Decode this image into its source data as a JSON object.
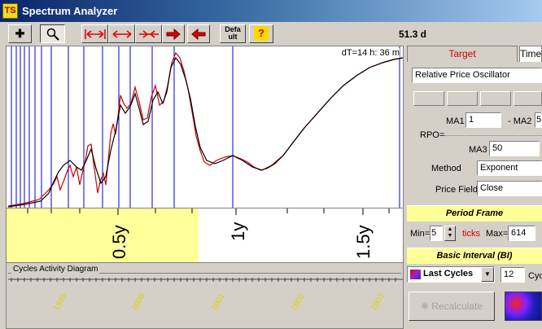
{
  "window": {
    "title": "Spectrum Analyzer",
    "logo_text": "TS"
  },
  "toolbar": {
    "buttons": [
      {
        "name": "crosshair-icon",
        "glyph": "✚"
      },
      {
        "name": "zoom-icon",
        "glyph": "🔍"
      },
      {
        "name": "range-both-icon"
      },
      {
        "name": "expand-icon"
      },
      {
        "name": "compress-icon"
      },
      {
        "name": "arrow-right-icon"
      },
      {
        "name": "arrow-left-icon"
      },
      {
        "name": "default-button",
        "label": "Defa ult"
      },
      {
        "name": "help-icon",
        "glyph": "?"
      }
    ],
    "period_readout": "51.3 d"
  },
  "plot": {
    "dt_label": "dT=14 h: 36 m",
    "x_axis_labels": [
      "0.5y",
      "1y",
      "1.5y"
    ],
    "colors": {
      "red_curve": "#cc0000",
      "black_curve": "#000000",
      "cycle_line": "#0000cc",
      "highlight": "#ffff99"
    }
  },
  "cycles": {
    "title": "Cycles Activity Diagram",
    "years": [
      "1999",
      "2000",
      "2001",
      "2002",
      "2003"
    ]
  },
  "panel": {
    "tabs": {
      "target": "Target",
      "time": "Time"
    },
    "indicator": "Relative Price Oscillator",
    "rpo_label": "RPO=",
    "ma1_label": "MA1",
    "ma1_value": "1",
    "ma2_label": "- MA2",
    "ma2_value": "5",
    "ma3_label": "MA3",
    "ma3_value": "50",
    "method_label": "Method",
    "method_value": "Exponent",
    "price_field_label": "Price Field",
    "price_field_value": "Close",
    "period_frame_title": "Period Frame",
    "min_label": "Min=",
    "min_value": "5",
    "ticks_label": "ticks",
    "max_label": "Max=",
    "max_value": "614",
    "basic_interval_title": "Basic Interval (BI)",
    "interval_mode": "Last Cycles",
    "interval_value": "12",
    "interval_unit": "Cyc",
    "recalculate_label": "Recalculate"
  }
}
